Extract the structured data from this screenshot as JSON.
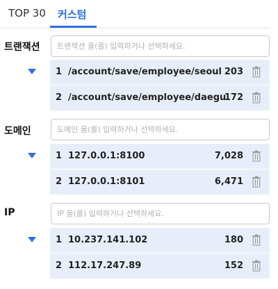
{
  "tabs": [
    {
      "label": "TOP 30",
      "active": false
    },
    {
      "label": "커스텀",
      "active": true
    }
  ],
  "colors": {
    "accent": "#2f6fe0",
    "row_bg": "#e8eef9",
    "border": "#c9c9c9"
  },
  "sections": [
    {
      "label": "트랜잭션",
      "placeholder": "트랜잭션 을(를) 입력하거나 선택하세요.",
      "expanded": true,
      "rows": [
        {
          "index": "1",
          "name": "/account/save/employee/seoul",
          "count": "203"
        },
        {
          "index": "2",
          "name": "/account/save/employee/daegu",
          "count": "172"
        }
      ]
    },
    {
      "label": "도메인",
      "placeholder": "도메인 을(를) 입력하거나 선택하세요.",
      "expanded": true,
      "rows": [
        {
          "index": "1",
          "name": "127.0.0.1:8100",
          "count": "7,028"
        },
        {
          "index": "2",
          "name": "127.0.0.1:8101",
          "count": "6,471"
        }
      ]
    },
    {
      "label": "IP",
      "placeholder": "IP 을(를) 입력하거나 선택하세요.",
      "expanded": true,
      "rows": [
        {
          "index": "1",
          "name": "10.237.141.102",
          "count": "180"
        },
        {
          "index": "2",
          "name": "112.17.247.89",
          "count": "152"
        }
      ]
    }
  ],
  "icons": {
    "delete": "trash-icon",
    "expand": "chevron-down-icon"
  }
}
